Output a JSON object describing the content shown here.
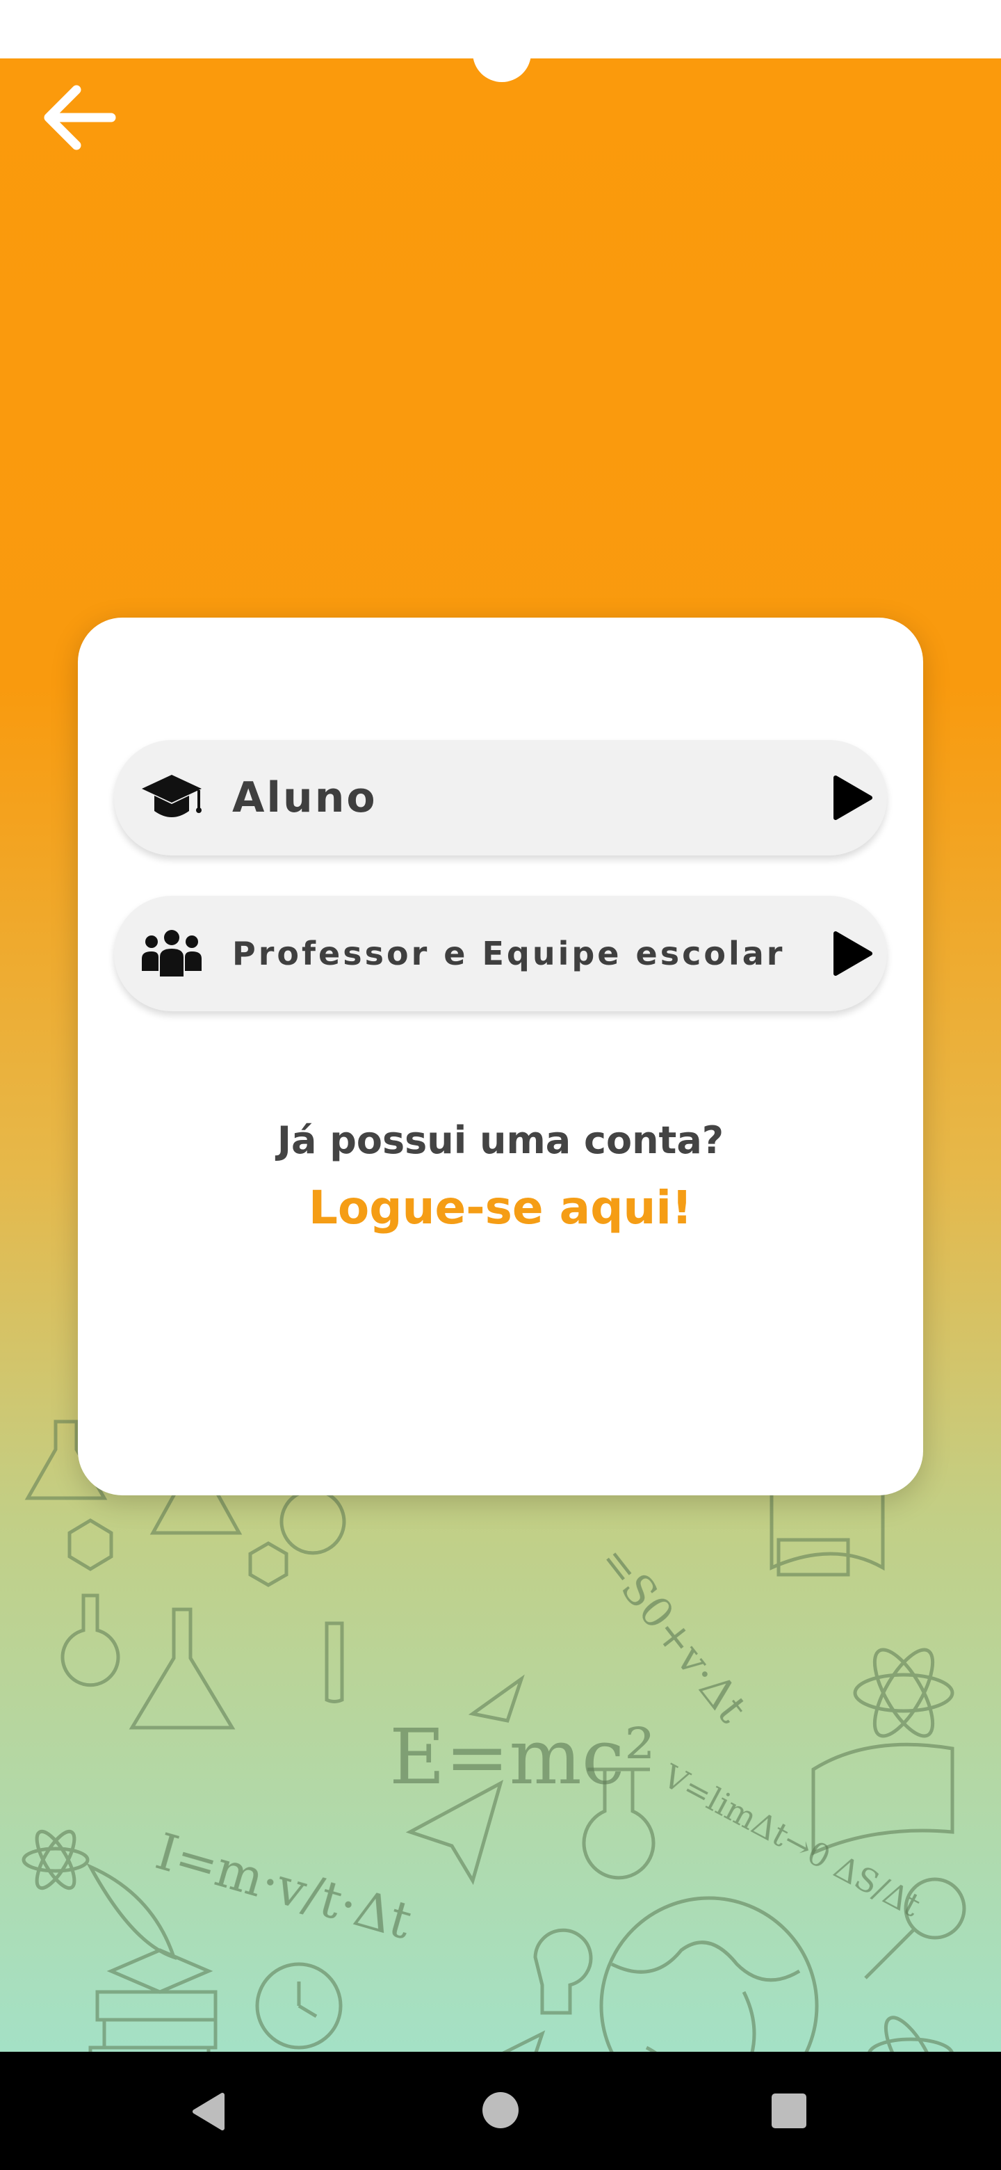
{
  "colors": {
    "accent": "#fb9a0c",
    "link": "#f59d15",
    "button_bg": "#f1f1f1",
    "gradient_bottom": "#a4e1c6",
    "text": "#3f3f3f"
  },
  "header": {
    "back_icon": "arrow-left-icon"
  },
  "background": {
    "formulas": [
      "E=mc²",
      "S=S0+v·Δt",
      "V=limΔt→0 ΔS/Δt",
      "I=m·v/t·Δt"
    ]
  },
  "card": {
    "options": [
      {
        "label": "Aluno",
        "icon": "graduation-cap-icon",
        "arrow_icon": "play-arrow-icon"
      },
      {
        "label": "Professor e Equipe escolar",
        "icon": "users-group-icon",
        "arrow_icon": "play-arrow-icon"
      }
    ],
    "have_account_text": "Já possui uma conta?",
    "login_link": "Logue-se aqui!"
  },
  "nav": {
    "back_icon": "nav-back-icon",
    "home_icon": "nav-home-icon",
    "recent_icon": "nav-recent-icon"
  }
}
